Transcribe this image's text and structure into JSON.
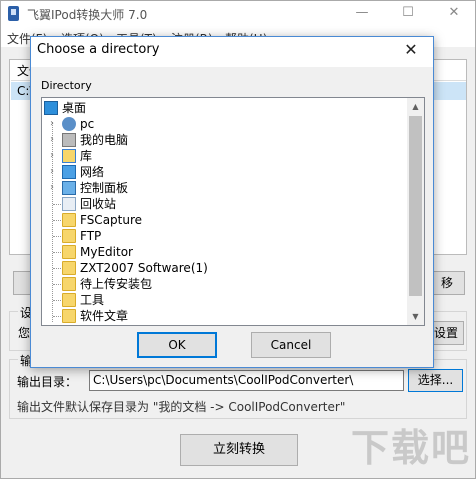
{
  "app": {
    "title": "飞翼IPod转换大师 7.0",
    "minimize": "—",
    "maximize": "☐",
    "close": "✕"
  },
  "menu": [
    "文件(F)",
    "选项(O)",
    "工具(T)",
    "注册(R)",
    "帮助(H)"
  ],
  "list": {
    "header": "文件",
    "row": "C:\\"
  },
  "background_buttons": {
    "right_btn": "移",
    "settings_btn": "设置"
  },
  "groups": {
    "settings_legend": "设置",
    "settings_text": "您",
    "output_legend": "输出"
  },
  "output": {
    "label": "输出目录：",
    "path": "C:\\Users\\pc\\Documents\\CoolIPodConverter\\",
    "browse": "选择...",
    "note": "输出文件默认保存目录为 \"我的文档 -> CoolIPodConverter\""
  },
  "convert_button": "立刻转换",
  "watermark": "下载吧",
  "dialog": {
    "title": "Choose a directory",
    "close": "✕",
    "directory_label": "Directory",
    "tree": [
      {
        "label": "桌面",
        "icon": "monitor-icon",
        "level": 0,
        "expandable": false
      },
      {
        "label": "pc",
        "icon": "user-icon",
        "level": 1,
        "expandable": true
      },
      {
        "label": "我的电脑",
        "icon": "computer-icon",
        "level": 1,
        "expandable": true
      },
      {
        "label": "库",
        "icon": "library-icon",
        "level": 1,
        "expandable": true
      },
      {
        "label": "网络",
        "icon": "network-icon",
        "level": 1,
        "expandable": true
      },
      {
        "label": "控制面板",
        "icon": "control-panel-icon",
        "level": 1,
        "expandable": true
      },
      {
        "label": "回收站",
        "icon": "recycle-bin-icon",
        "level": 1,
        "expandable": false
      },
      {
        "label": "FSCapture",
        "icon": "folder-icon",
        "level": 1,
        "expandable": false
      },
      {
        "label": "FTP",
        "icon": "folder-icon",
        "level": 1,
        "expandable": false
      },
      {
        "label": "MyEditor",
        "icon": "folder-icon",
        "level": 1,
        "expandable": false
      },
      {
        "label": "ZXT2007 Software(1)",
        "icon": "folder-icon",
        "level": 1,
        "expandable": false
      },
      {
        "label": "待上传安装包",
        "icon": "folder-icon",
        "level": 1,
        "expandable": false
      },
      {
        "label": "工具",
        "icon": "folder-icon",
        "level": 1,
        "expandable": false
      },
      {
        "label": "软件文章",
        "icon": "folder-icon",
        "level": 1,
        "expandable": false
      }
    ],
    "ok": "OK",
    "cancel": "Cancel"
  }
}
